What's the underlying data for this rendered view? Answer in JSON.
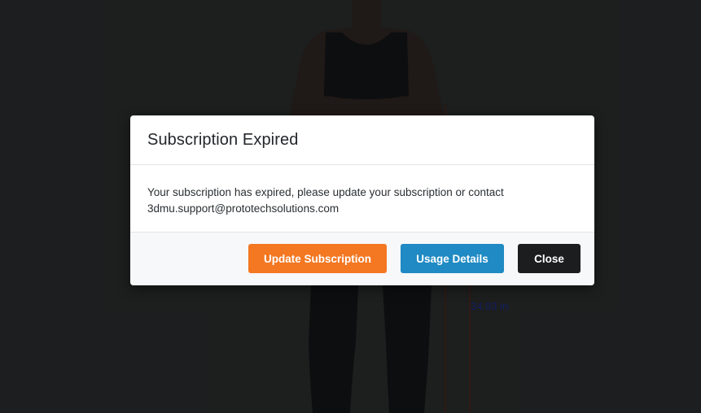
{
  "background": {
    "measurement_label": "34.93 in",
    "colors": {
      "backdrop": "#2a2b2c",
      "skin": "#2d2421",
      "garment": "#141516",
      "measure_line": "#4a241c",
      "measure_text": "#1b2b8c"
    }
  },
  "dialog": {
    "title": "Subscription Expired",
    "message": "Your subscription has expired, please update your subscription or contact 3dmu.support@prototechsolutions.com",
    "buttons": {
      "update_label": "Update Subscription",
      "usage_label": "Usage Details",
      "close_label": "Close"
    },
    "colors": {
      "update": "#f47721",
      "usage": "#1f8ac3",
      "close": "#1c1d1f"
    }
  }
}
